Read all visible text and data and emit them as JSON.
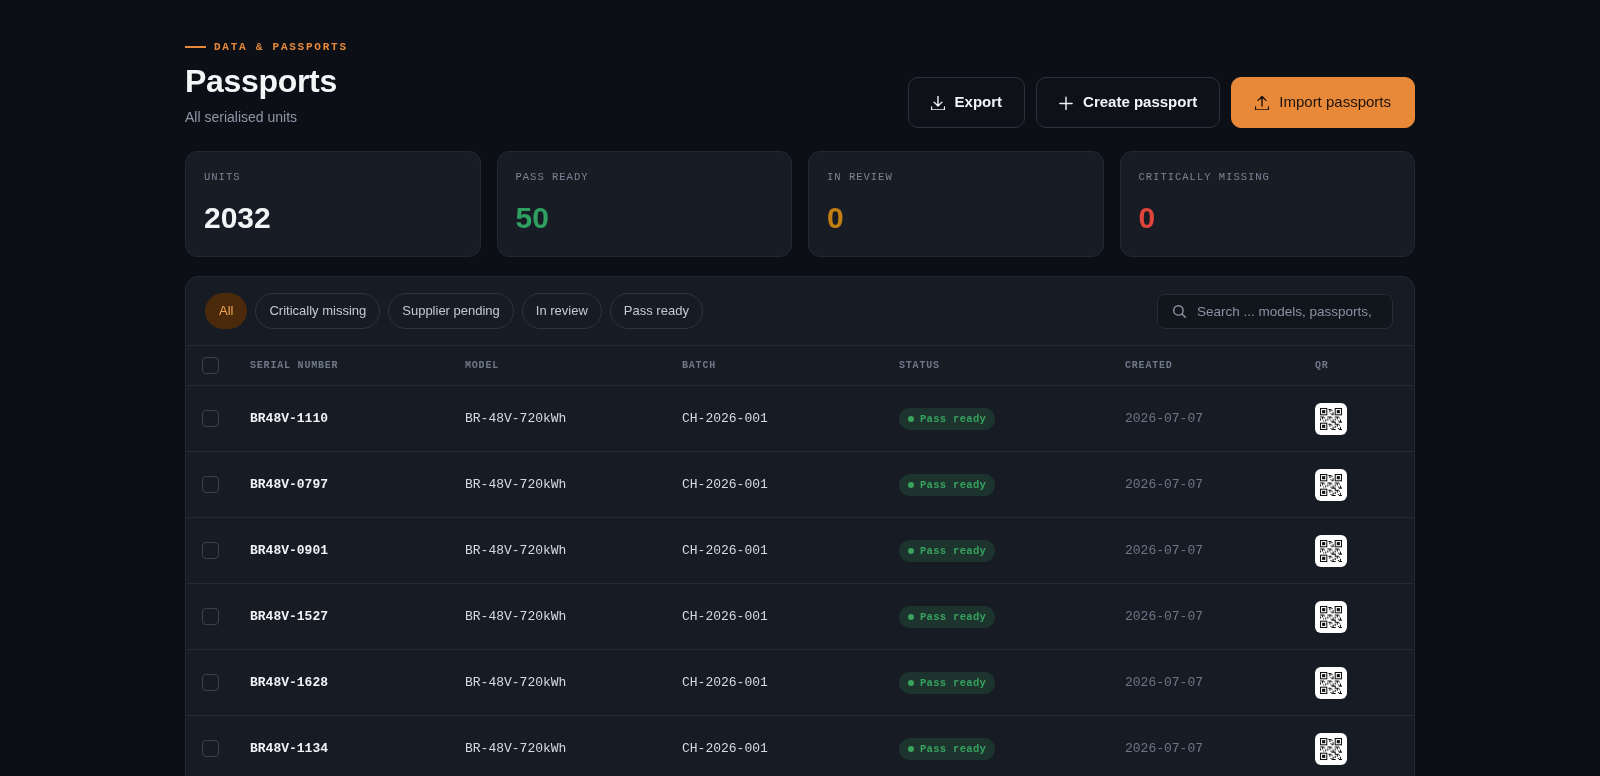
{
  "header": {
    "eyebrow": "DATA & PASSPORTS",
    "title": "Passports",
    "subtitle": "All serialised units"
  },
  "actions": [
    {
      "label": "Export",
      "kind": "export",
      "primary": false
    },
    {
      "label": "Create passport",
      "kind": "create",
      "primary": false
    },
    {
      "label": "Import passports",
      "kind": "import",
      "primary": true
    }
  ],
  "stats": [
    {
      "label": "UNITS",
      "value": "2032",
      "color": "#f3f4f6"
    },
    {
      "label": "PASS READY",
      "value": "50",
      "color": "#30a060"
    },
    {
      "label": "IN REVIEW",
      "value": "0",
      "color": "#c47f12"
    },
    {
      "label": "CRITICALLY MISSING",
      "value": "0",
      "color": "#e0443a"
    }
  ],
  "filters": [
    {
      "label": "All",
      "selected": true
    },
    {
      "label": "Critically missing",
      "selected": false
    },
    {
      "label": "Supplier pending",
      "selected": false
    },
    {
      "label": "In review",
      "selected": false
    },
    {
      "label": "Pass ready",
      "selected": false
    }
  ],
  "search": {
    "placeholder": "Search ... models, passports,"
  },
  "table": {
    "select_all": {
      "checked": false
    },
    "columns": [
      "SERIAL NUMBER",
      "MODEL",
      "BATCH",
      "STATUS",
      "CREATED",
      "QR"
    ],
    "rows": [
      {
        "checked": false,
        "serial": "BR48V-1110",
        "model": "BR-48V-720kWh",
        "batch": "CH-2026-001",
        "status": {
          "label": "Pass ready",
          "color": "#38a35e"
        },
        "created": "2026-07-07"
      },
      {
        "checked": false,
        "serial": "BR48V-0797",
        "model": "BR-48V-720kWh",
        "batch": "CH-2026-001",
        "status": {
          "label": "Pass ready",
          "color": "#38a35e"
        },
        "created": "2026-07-07"
      },
      {
        "checked": false,
        "serial": "BR48V-0901",
        "model": "BR-48V-720kWh",
        "batch": "CH-2026-001",
        "status": {
          "label": "Pass ready",
          "color": "#38a35e"
        },
        "created": "2026-07-07"
      },
      {
        "checked": false,
        "serial": "BR48V-1527",
        "model": "BR-48V-720kWh",
        "batch": "CH-2026-001",
        "status": {
          "label": "Pass ready",
          "color": "#38a35e"
        },
        "created": "2026-07-07"
      },
      {
        "checked": false,
        "serial": "BR48V-1628",
        "model": "BR-48V-720kWh",
        "batch": "CH-2026-001",
        "status": {
          "label": "Pass ready",
          "color": "#38a35e"
        },
        "created": "2026-07-07"
      },
      {
        "checked": false,
        "serial": "BR48V-1134",
        "model": "BR-48V-720kWh",
        "batch": "CH-2026-001",
        "status": {
          "label": "Pass ready",
          "color": "#38a35e"
        },
        "created": "2026-07-07"
      }
    ]
  }
}
